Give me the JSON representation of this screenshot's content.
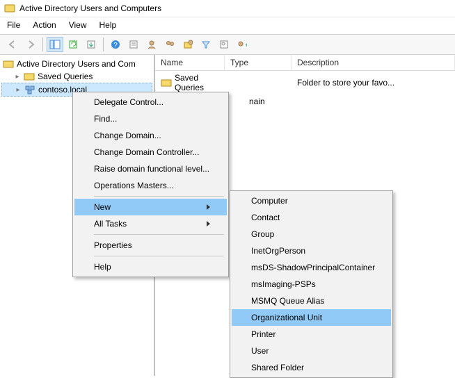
{
  "window": {
    "title": "Active Directory Users and Computers"
  },
  "menubar": {
    "file": "File",
    "action": "Action",
    "view": "View",
    "help": "Help"
  },
  "tree": {
    "root": "Active Directory Users and Com",
    "saved_queries": "Saved Queries",
    "domain": "contoso.local"
  },
  "list": {
    "headers": {
      "name": "Name",
      "type": "Type",
      "description": "Description"
    },
    "rows": [
      {
        "name": "Saved Queries",
        "type": "",
        "description": "Folder to store your favo..."
      },
      {
        "name_fragment": "nain",
        "type": "",
        "description": ""
      }
    ]
  },
  "context_menu": {
    "items": [
      "Delegate Control...",
      "Find...",
      "Change Domain...",
      "Change Domain Controller...",
      "Raise domain functional level...",
      "Operations Masters..."
    ],
    "new": "New",
    "all_tasks": "All Tasks",
    "properties": "Properties",
    "help": "Help"
  },
  "submenu": {
    "items": [
      "Computer",
      "Contact",
      "Group",
      "InetOrgPerson",
      "msDS-ShadowPrincipalContainer",
      "msImaging-PSPs",
      "MSMQ Queue Alias",
      "Organizational Unit",
      "Printer",
      "User",
      "Shared Folder"
    ],
    "highlight_index": 7
  }
}
